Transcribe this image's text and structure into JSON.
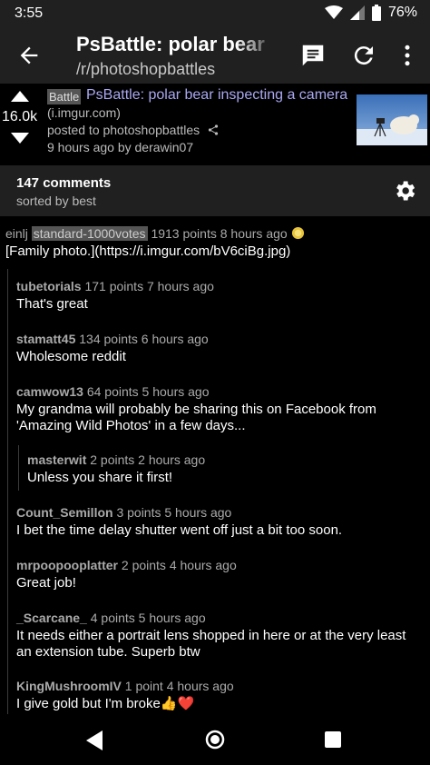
{
  "status_bar": {
    "time": "3:55",
    "battery": "76%"
  },
  "app_bar": {
    "title": "PsBattle: polar bear i",
    "subtitle": "/r/photoshopbattles"
  },
  "post": {
    "score": "16.0k",
    "flair": "Battle",
    "title": "PsBattle: polar bear inspecting a camera",
    "domain": "(i.imgur.com)",
    "subreddit_line": "posted to photoshopbattles",
    "time_author": "9 hours ago by derawin07"
  },
  "comments_header": {
    "count": "147 comments",
    "sort": "sorted by best"
  },
  "comments": [
    {
      "author": "einlj",
      "flair": "standard-1000votes",
      "meta": "1913 points 8 hours ago",
      "body": "[Family photo.](https://i.imgur.com/bV6ciBg.jpg)"
    },
    {
      "author": "tubetorials",
      "meta": "171 points 7 hours ago",
      "body": "That's great"
    },
    {
      "author": "stamatt45",
      "meta": "134 points 6 hours ago",
      "body": "Wholesome reddit"
    },
    {
      "author": "camwow13",
      "meta": "64 points 5 hours ago",
      "body": "My grandma will probably be sharing this on Facebook from 'Amazing Wild Photos' in a few days..."
    },
    {
      "author": "masterwit",
      "meta": "2 points 2 hours ago",
      "body": "Unless you share it first!"
    },
    {
      "author": "Count_Semillon",
      "meta": "3 points 5 hours ago",
      "body": "I bet the time delay shutter went off just a bit too soon."
    },
    {
      "author": "mrpoopooplatter",
      "meta": "2 points 4 hours ago",
      "body": "Great job!"
    },
    {
      "author": "_Scarcane_",
      "meta": "4 points 5 hours ago",
      "body": "It needs either a portrait lens shopped in here or at the very least an extension tube. Superb btw"
    },
    {
      "author": "KingMushroomIV",
      "meta": "1 point 4 hours ago",
      "body": "I give gold but I'm broke👍❤️"
    }
  ],
  "colors": {
    "toolbar": "#202020",
    "link": "#a9a7f2",
    "background": "#000000"
  },
  "icons": [
    "back-arrow-icon",
    "comment-icon",
    "refresh-icon",
    "overflow-menu-icon",
    "upvote-icon",
    "downvote-icon",
    "share-icon",
    "settings-gear-icon",
    "gold-award-icon",
    "nav-back-icon",
    "nav-home-icon",
    "nav-recents-icon"
  ]
}
